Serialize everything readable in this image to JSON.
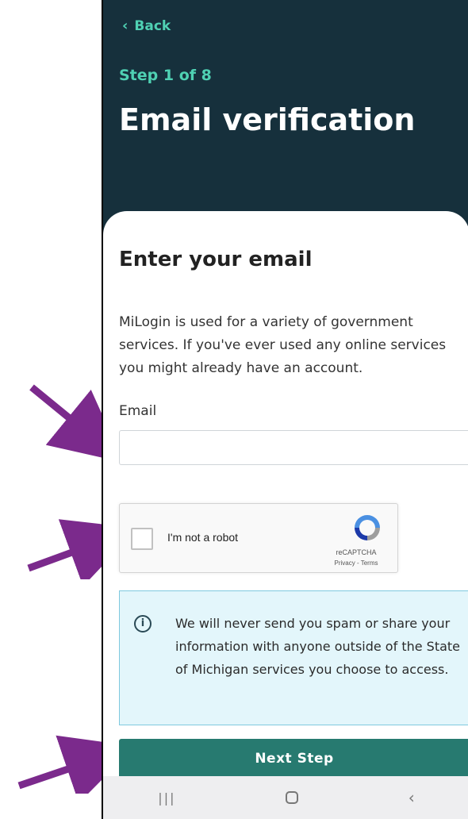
{
  "header": {
    "back_label": "Back",
    "step": "Step 1 of 8",
    "title": "Email verification"
  },
  "form": {
    "heading": "Enter your email",
    "intro": "MiLogin is used for a variety of government services. If you've ever used any online services you might already have an account.",
    "email_label": "Email",
    "email_value": "",
    "email_placeholder": ""
  },
  "captcha": {
    "label": "I'm not a robot",
    "brand": "reCAPTCHA",
    "links": "Privacy - Terms"
  },
  "notice": {
    "icon": "info-icon",
    "text": "We will never send you spam or share your information with anyone outside of the State of Michigan services you choose to access."
  },
  "next_button": "Next Step",
  "android_nav": {
    "recent": "recent-apps-icon",
    "home": "home-icon",
    "back": "back-icon"
  },
  "colors": {
    "header_bg": "#16303c",
    "accent": "#4fd1b3",
    "button": "#277a70",
    "notice_bg": "#e3f6fb",
    "annotation_arrow": "#7b2a8c"
  }
}
